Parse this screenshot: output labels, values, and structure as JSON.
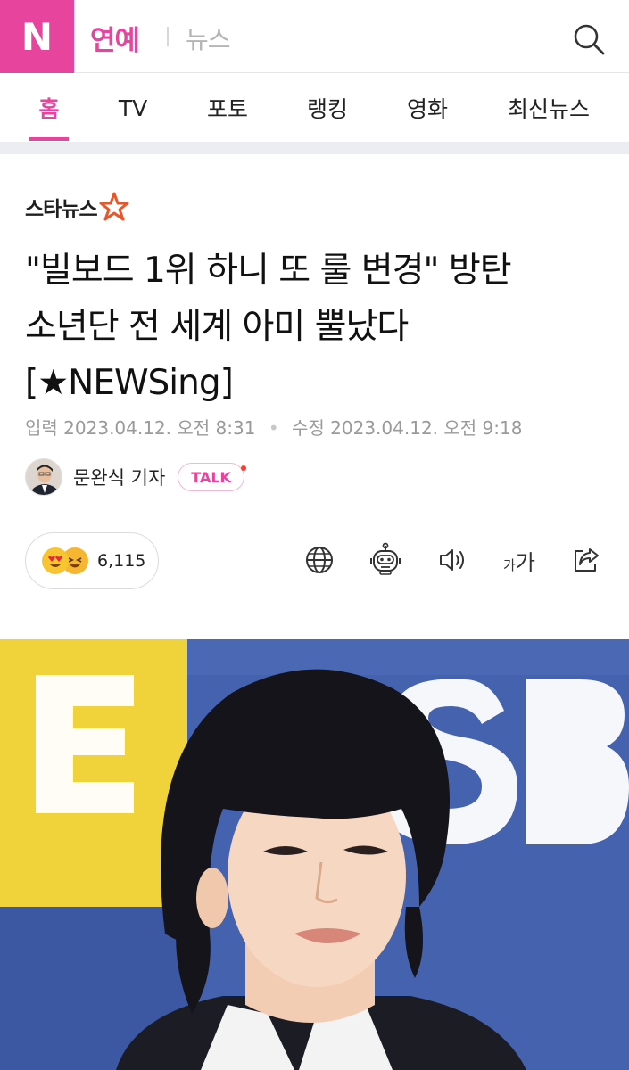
{
  "header": {
    "logo": "N",
    "section_title": "연예",
    "sub_title": "뉴스",
    "search_icon": "search-icon"
  },
  "nav": {
    "tabs": [
      {
        "label": "홈",
        "active": true
      },
      {
        "label": "TV",
        "active": false
      },
      {
        "label": "포토",
        "active": false
      },
      {
        "label": "랭킹",
        "active": false
      },
      {
        "label": "영화",
        "active": false
      },
      {
        "label": "최신뉴스",
        "active": false
      }
    ]
  },
  "article": {
    "press": "스타뉴스",
    "headline_lines": [
      "\"빌보드 1위 하니 또 룰 변경\" 방탄",
      "소년단 전 세계 아미 뿔났다",
      "[★NEWSing]"
    ],
    "input_label": "입력",
    "input_date": "2023.04.12. 오전 8:31",
    "modified_label": "수정",
    "modified_date": "2023.04.12. 오전 9:18",
    "reporter": "문완식 기자",
    "talk_label": "TALK",
    "reactions": {
      "count": "6,115",
      "emojis": [
        "heart-eyes-emoji-icon",
        "laughing-emoji-icon"
      ]
    },
    "tools": {
      "translate_icon": "globe-icon",
      "summary_icon": "robot-icon",
      "audio_icon": "speaker-icon",
      "fontsize_small": "가",
      "fontsize_large": "가",
      "share_icon": "share-icon"
    }
  },
  "colors": {
    "brand_pink": "#e6449d",
    "photo_blue": "#3f5ea8",
    "photo_yellow": "#f2d53c"
  }
}
